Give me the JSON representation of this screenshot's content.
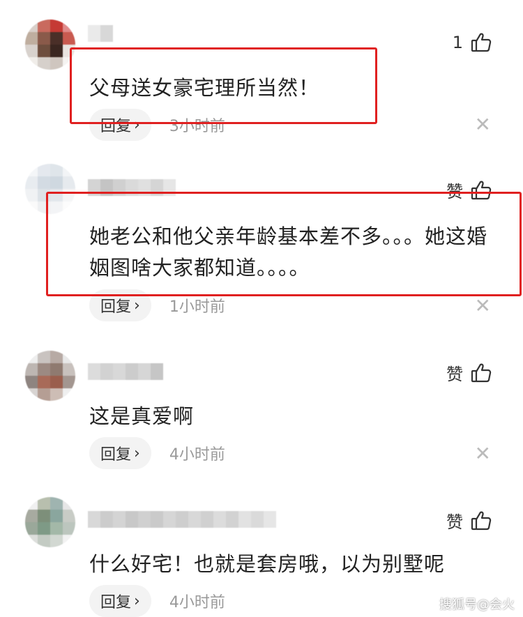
{
  "colors": {
    "highlight": "#e02020",
    "meta_text": "#999999",
    "reply_bg": "#f3f3f3"
  },
  "comments": [
    {
      "like_label": "1",
      "text": "父母送女豪宅理所当然！",
      "reply_label": "回复",
      "time": "3小时前"
    },
    {
      "like_label": "赞",
      "text": "她老公和他父亲年龄基本差不多。。。她这婚姻图啥大家都知道。。。。",
      "reply_label": "回复",
      "time": "1小时前"
    },
    {
      "like_label": "赞",
      "text": "这是真爱啊",
      "reply_label": "回复",
      "time": "4小时前"
    },
    {
      "like_label": "赞",
      "text": "什么好宅！也就是套房哦，以为别墅呢",
      "reply_label": "回复",
      "time": "4小时前"
    }
  ],
  "icons": {
    "like": "thumbs-up-icon",
    "close": "close-icon",
    "chevron": "chevron-right-icon"
  },
  "watermark": "搜狐号@会火"
}
